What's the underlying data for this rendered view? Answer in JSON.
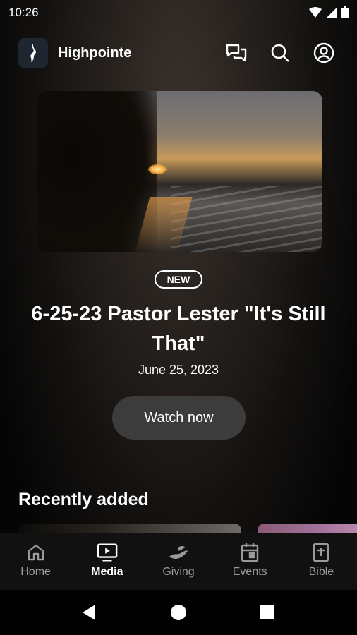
{
  "status": {
    "time": "10:26",
    "icons": [
      "wifi-icon",
      "signal-icon",
      "battery-icon"
    ]
  },
  "app": {
    "title": "Highpointe"
  },
  "appbar_actions": [
    "chat-icon",
    "search-icon",
    "account-icon"
  ],
  "featured": {
    "badge": "NEW",
    "title": "6-25-23 Pastor Lester \"It's Still That\"",
    "date": "June 25, 2023",
    "cta": "Watch now"
  },
  "recent": {
    "heading": "Recently added"
  },
  "nav": {
    "items": [
      {
        "label": "Home",
        "icon": "home-icon",
        "active": false
      },
      {
        "label": "Media",
        "icon": "media-icon",
        "active": true
      },
      {
        "label": "Giving",
        "icon": "giving-icon",
        "active": false
      },
      {
        "label": "Events",
        "icon": "calendar-icon",
        "active": false
      },
      {
        "label": "Bible",
        "icon": "bible-icon",
        "active": false
      }
    ]
  },
  "system_nav": [
    "back-icon",
    "home-circle-icon",
    "recents-icon"
  ],
  "colors": {
    "nav_bg": "#111111",
    "button_bg": "#3c3c3c",
    "inactive": "#9a9a9a"
  }
}
